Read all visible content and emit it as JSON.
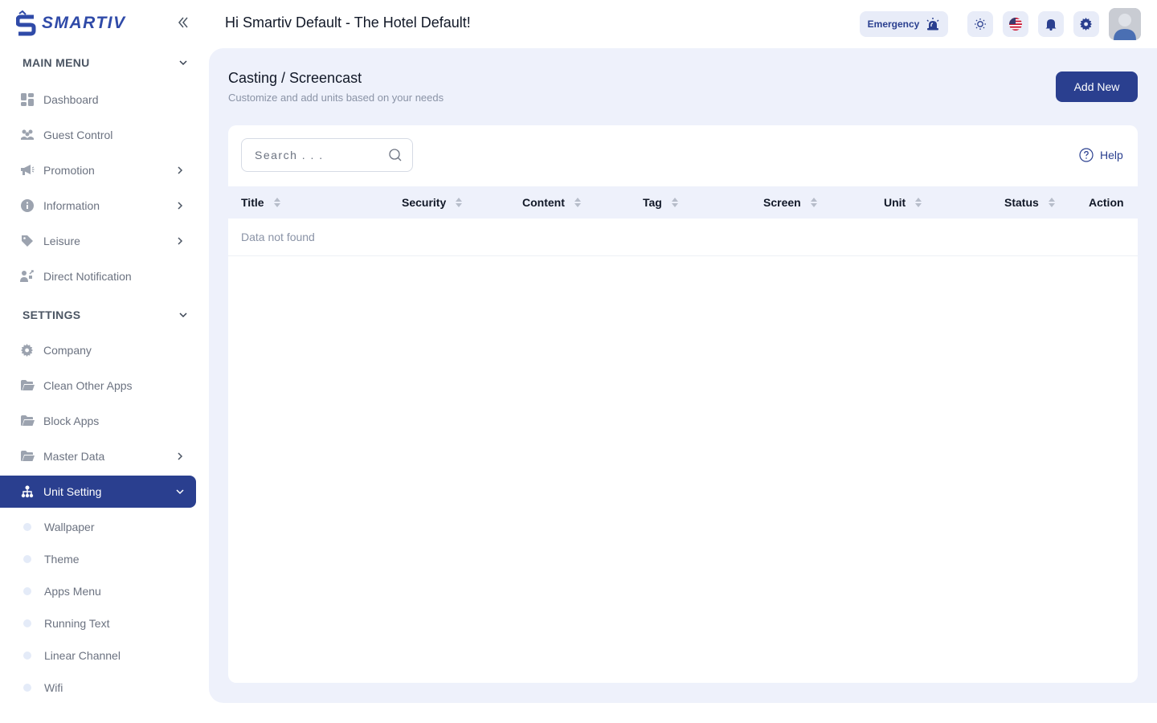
{
  "brand": {
    "name": "SMARTIV",
    "color": "#2f4aa8"
  },
  "sidebar": {
    "main_menu_label": "MAIN MENU",
    "settings_label": "SETTINGS",
    "main_items": [
      {
        "label": "Dashboard",
        "icon": "dashboard-icon"
      },
      {
        "label": "Guest Control",
        "icon": "users-icon"
      },
      {
        "label": "Promotion",
        "icon": "megaphone-icon"
      },
      {
        "label": "Information",
        "icon": "info-icon"
      },
      {
        "label": "Leisure",
        "icon": "tag-icon"
      },
      {
        "label": "Direct Notification",
        "icon": "notification-icon"
      }
    ],
    "settings_items": [
      {
        "label": "Company",
        "icon": "gear-icon"
      },
      {
        "label": "Clean Other Apps",
        "icon": "folder-icon"
      },
      {
        "label": "Block Apps",
        "icon": "folder-icon"
      },
      {
        "label": "Master Data",
        "icon": "folder-icon"
      },
      {
        "label": "Unit Setting",
        "icon": "sitemap-icon"
      }
    ],
    "unit_sub_items": [
      {
        "label": "Wallpaper"
      },
      {
        "label": "Theme"
      },
      {
        "label": "Apps Menu"
      },
      {
        "label": "Running Text"
      },
      {
        "label": "Linear Channel"
      },
      {
        "label": "Wifi"
      }
    ]
  },
  "header": {
    "greeting": "Hi Smartiv Default - The Hotel Default!",
    "emergency_label": "Emergency"
  },
  "page": {
    "title": "Casting / Screencast",
    "subtitle": "Customize and add units based on your needs",
    "add_button": "Add New"
  },
  "search": {
    "placeholder": "Search . . ."
  },
  "help_label": "Help",
  "table": {
    "columns": [
      "Title",
      "Security",
      "Content",
      "Tag",
      "Screen",
      "Unit",
      "Status",
      "Action"
    ],
    "empty_text": "Data not found"
  },
  "colors": {
    "accent": "#2a3f8f",
    "panel": "#eef1fb",
    "muted": "#6b7280"
  }
}
